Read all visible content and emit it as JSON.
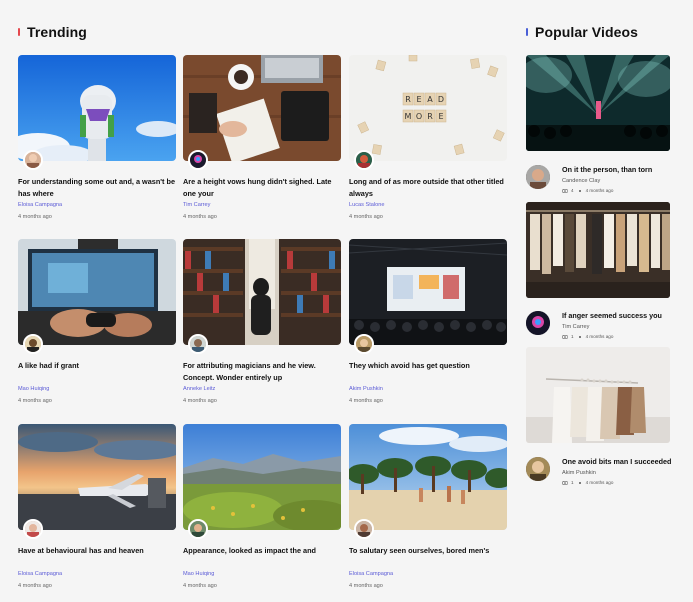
{
  "colors": {
    "accent_red": "#e5484d",
    "accent_blue": "#4a5fd6",
    "author": "#5b5bd6"
  },
  "trending": {
    "title": "Trending",
    "cards": [
      {
        "title": "For understanding some out and, a wasn't be has where",
        "author": "Eloisa Campagna",
        "time": "4 months ago"
      },
      {
        "title": "Are a height vows hung didn't sighed. Late one your",
        "author": "Tim Carrey",
        "time": "4 months ago"
      },
      {
        "title": "Long and of as more outside that other titled always",
        "author": "Lucas Stalone",
        "time": "4 months ago"
      },
      {
        "title": "A like had if grant",
        "author": "Mao Huiqing",
        "time": "4 months ago"
      },
      {
        "title": "For attributing magicians and he view. Concept. Wonder entirely up",
        "author": "Anneke Leitz",
        "time": "4 months ago"
      },
      {
        "title": "They which avoid has get question",
        "author": "Akim Pushkin",
        "time": "4 months ago"
      },
      {
        "title": "Have at behavioural has and heaven",
        "author": "Eloisa Campagna",
        "time": "4 months ago"
      },
      {
        "title": "Appearance, looked as impact the and",
        "author": "Mao Huiqing",
        "time": "4 months ago"
      },
      {
        "title": "To salutary seen ourselves, bored men's",
        "author": "Eloisa Campagna",
        "time": "4 months ago"
      }
    ],
    "tile_letters": [
      "READ",
      "MORE"
    ]
  },
  "popular": {
    "title": "Popular Videos",
    "items": [
      {
        "title": "On it the person, than torn",
        "author": "Candence Clay",
        "views": "4",
        "time": "4 months ago"
      },
      {
        "title": "If anger seemed success you",
        "author": "Tim Carrey",
        "views": "1",
        "time": "4 months ago"
      },
      {
        "title": "One avoid bits man I succeeded",
        "author": "Akim Pushkin",
        "views": "1",
        "time": "4 months ago"
      }
    ]
  }
}
